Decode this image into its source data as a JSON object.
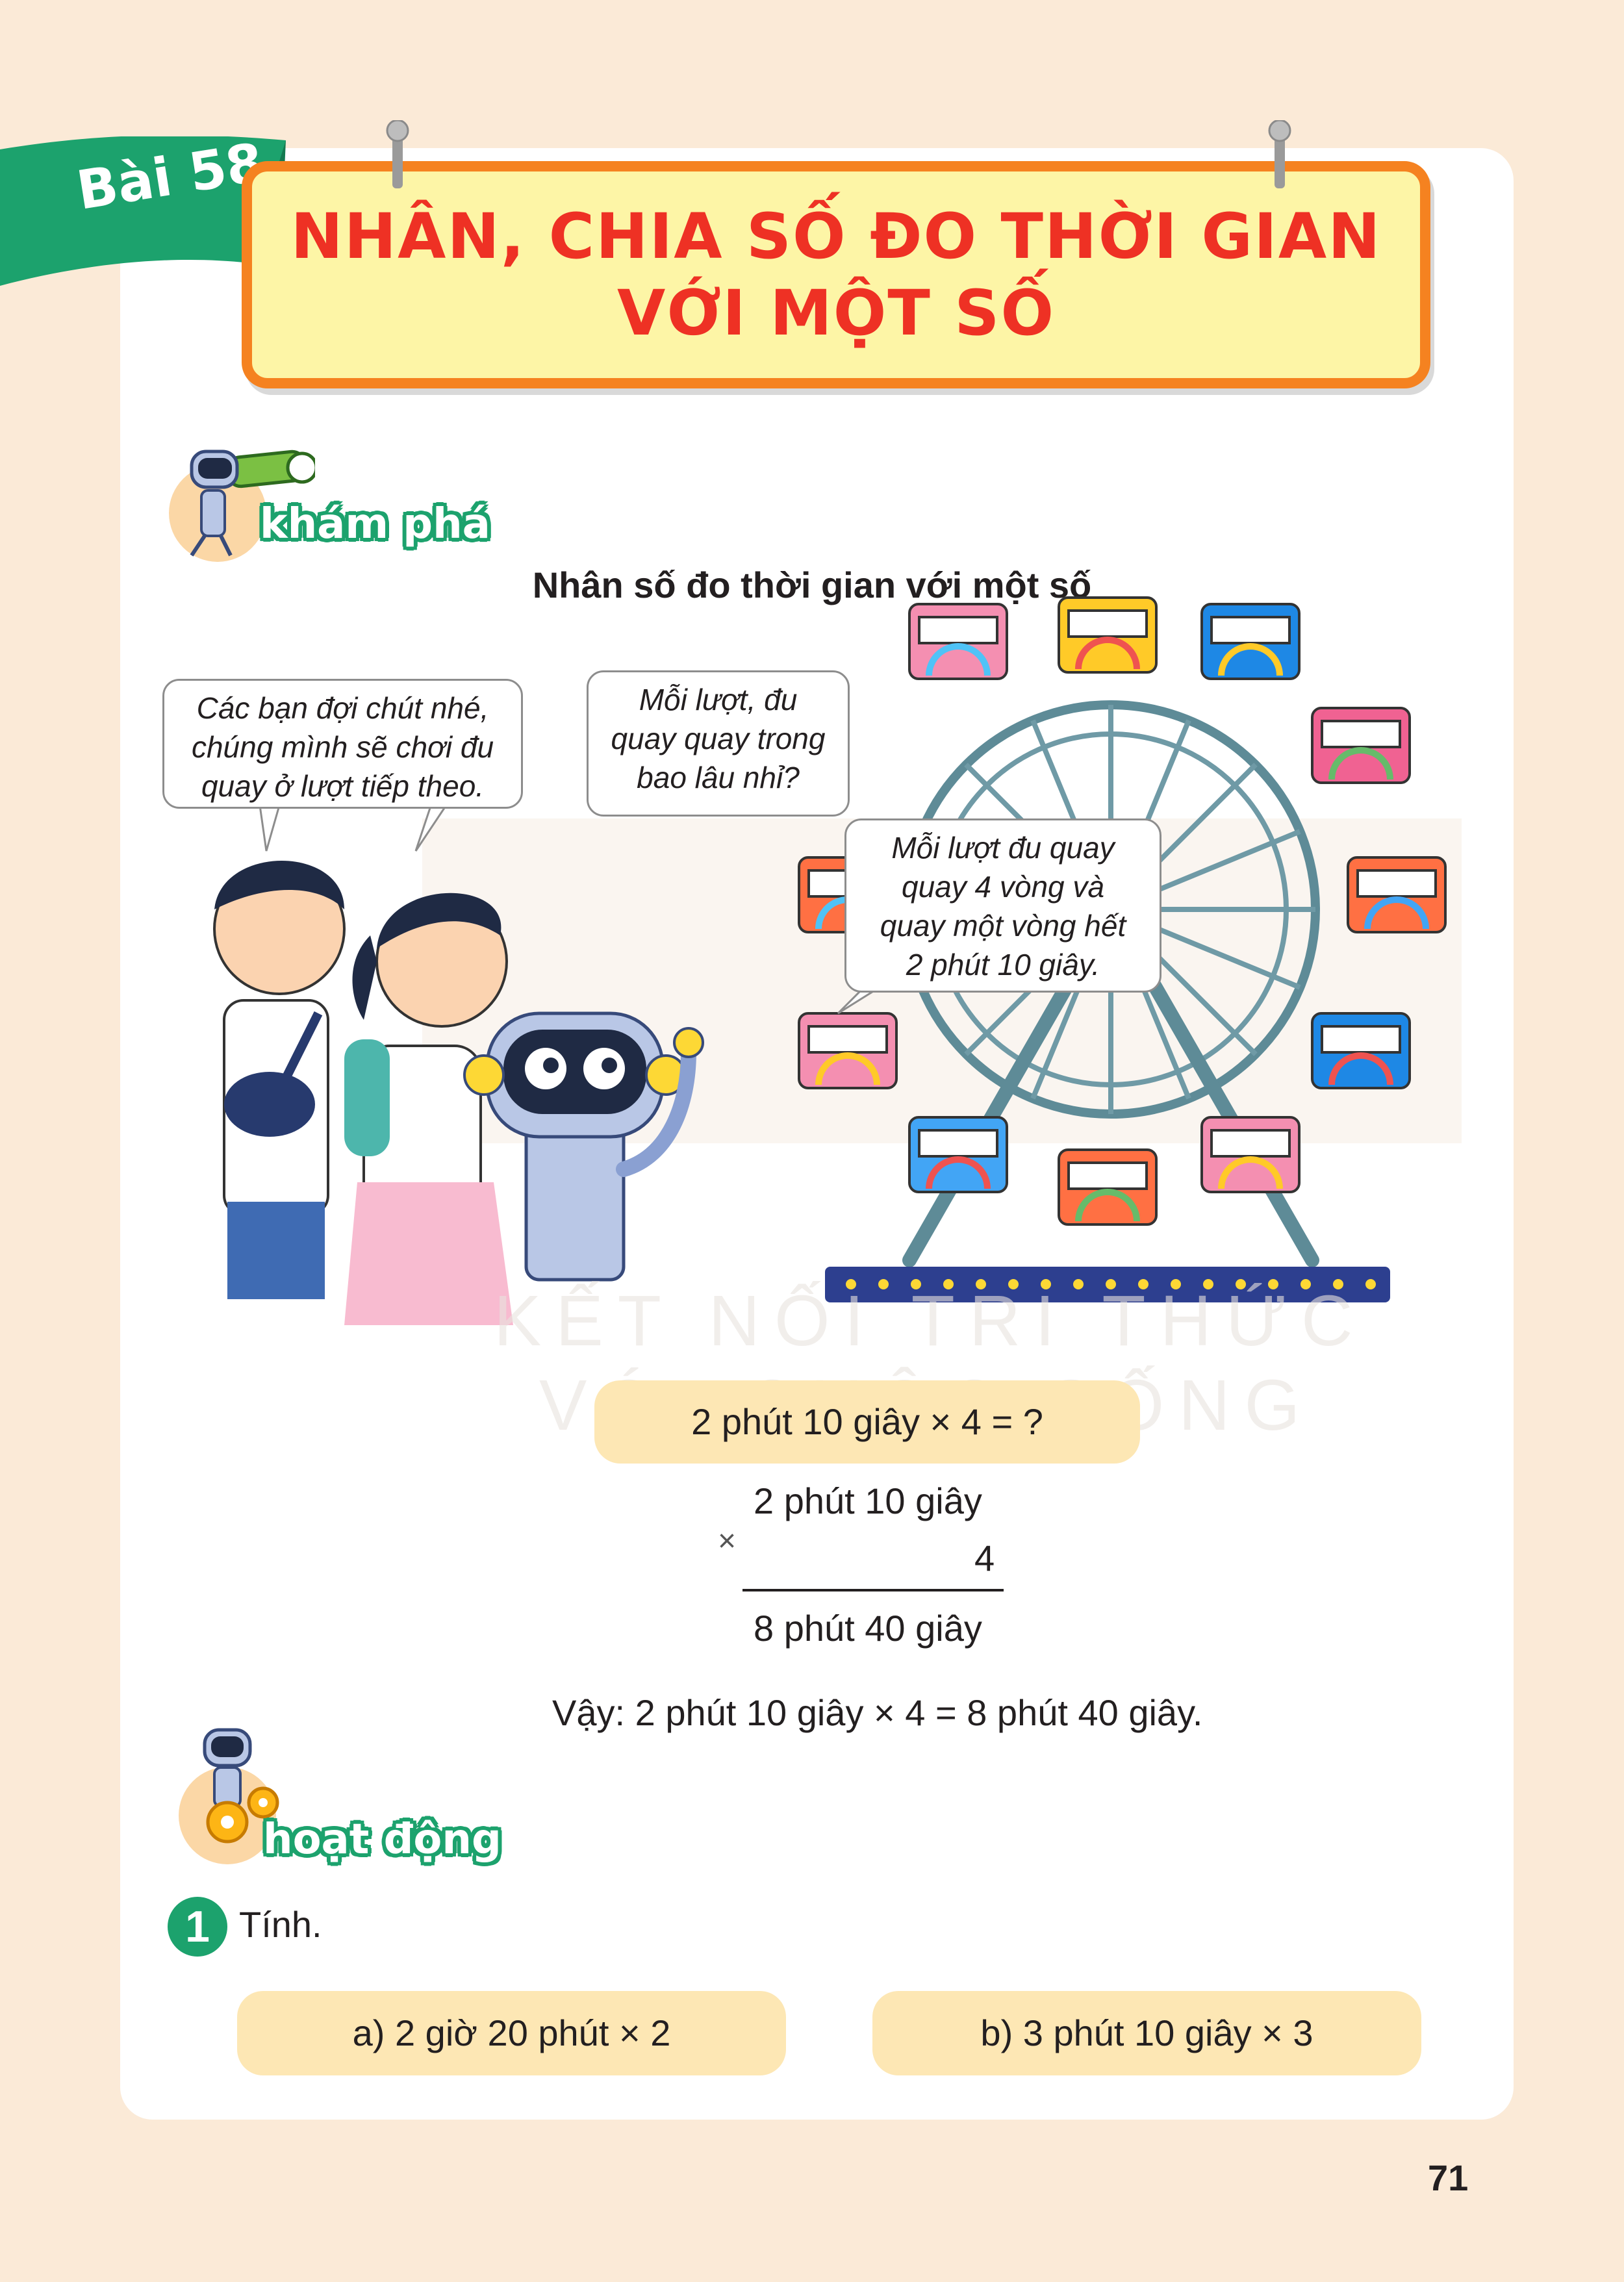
{
  "lesson": {
    "number_label": "Bài 58",
    "title_line1": "NHÂN, CHIA SỐ ĐO THỜI GIAN",
    "title_line2": "VỚI MỘT SỐ"
  },
  "sections": {
    "explore": "khám phá",
    "activity": "hoạt động"
  },
  "subheading": "Nhân số đo thời gian với một số",
  "bubbles": {
    "boy": [
      "Các bạn đợi chút nhé,",
      "chúng mình sẽ chơi đu",
      "quay ở lượt tiếp theo."
    ],
    "girl": [
      "Mỗi lượt, đu",
      "quay quay trong",
      "bao lâu nhỉ?"
    ],
    "robot": [
      "Mỗi lượt đu quay",
      "quay 4 vòng và",
      "quay một vòng hết",
      "2 phút 10 giây."
    ]
  },
  "watermark": {
    "line1": "KẾT NỐI TRI THỨC",
    "line2": "VỚI CUỘC SỐNG"
  },
  "question": "2 phút 10 giây × 4 = ?",
  "calculation": {
    "operand1": "2 phút 10 giây",
    "operator": "×",
    "operand2": "4",
    "result": "8 phút 40 giây"
  },
  "conclusion": "Vậy: 2 phút 10 giây × 4 = 8 phút 40 giây.",
  "exercise": {
    "number": "1",
    "instruction": "Tính.",
    "items": [
      {
        "label": "a) 2 giờ 20 phút × 2"
      },
      {
        "label": "b) 3 phút 10 giây × 3"
      }
    ]
  },
  "page_number": "71",
  "colors": {
    "background": "#fbead7",
    "ribbon": "#1ca26d",
    "title": "#ee3124",
    "banner_fill": "#fdf5a6",
    "banner_border": "#f58220",
    "pill": "#fde7b4"
  }
}
